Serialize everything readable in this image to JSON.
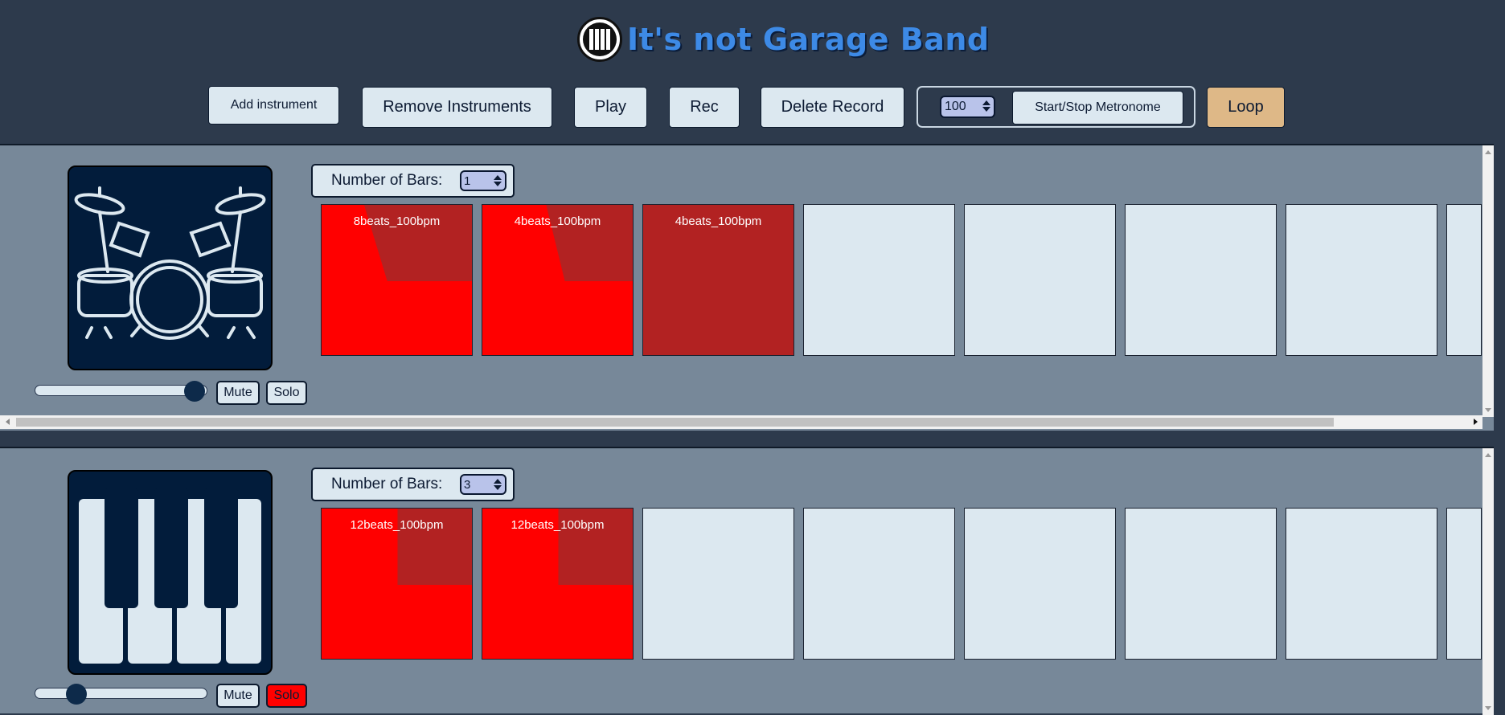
{
  "app": {
    "title": "It's not Garage Band",
    "logo_icon": "piano-logo-icon"
  },
  "toolbar": {
    "add_label": "Add instrument",
    "remove_label": "Remove Instruments",
    "play_label": "Play",
    "rec_label": "Rec",
    "delete_label": "Delete Record",
    "bpm_value": "100",
    "metronome_label": "Start/Stop Metronome",
    "loop_label": "Loop",
    "loop_color": "#deb887"
  },
  "tracks": [
    {
      "instrument_icon": "drum-kit-icon",
      "bars_label": "Number of Bars:",
      "bars_value": "1",
      "volume_level": 0.98,
      "mute_label": "Mute",
      "solo_label": "Solo",
      "solo_active": false,
      "clips": [
        {
          "label": "8beats_100bpm",
          "state": "recorded",
          "progress": 0.28
        },
        {
          "label": "4beats_100bpm",
          "state": "recorded",
          "progress": 0.42
        },
        {
          "label": "4beats_100bpm",
          "state": "playing",
          "progress": 1.0
        },
        {
          "label": "",
          "state": "empty"
        },
        {
          "label": "",
          "state": "empty"
        },
        {
          "label": "",
          "state": "empty"
        },
        {
          "label": "",
          "state": "empty"
        },
        {
          "label": "",
          "state": "empty"
        }
      ]
    },
    {
      "instrument_icon": "piano-keys-icon",
      "bars_label": "Number of Bars:",
      "bars_value": "3",
      "volume_level": 0.2,
      "mute_label": "Mute",
      "solo_label": "Solo",
      "solo_active": true,
      "clips": [
        {
          "label": "12beats_100bpm",
          "state": "recorded",
          "progress": 0.5
        },
        {
          "label": "12beats_100bpm",
          "state": "recorded",
          "progress": 0.5
        },
        {
          "label": "",
          "state": "empty"
        },
        {
          "label": "",
          "state": "empty"
        },
        {
          "label": "",
          "state": "empty"
        },
        {
          "label": "",
          "state": "empty"
        },
        {
          "label": "",
          "state": "empty"
        },
        {
          "label": "",
          "state": "empty"
        }
      ]
    }
  ],
  "colors": {
    "background": "#2d3a4c",
    "panel": "#778899",
    "clip_recorded": "#ff0000",
    "clip_played": "#b22222",
    "clip_empty": "#dce8f0",
    "title": "#3d8ae6"
  }
}
